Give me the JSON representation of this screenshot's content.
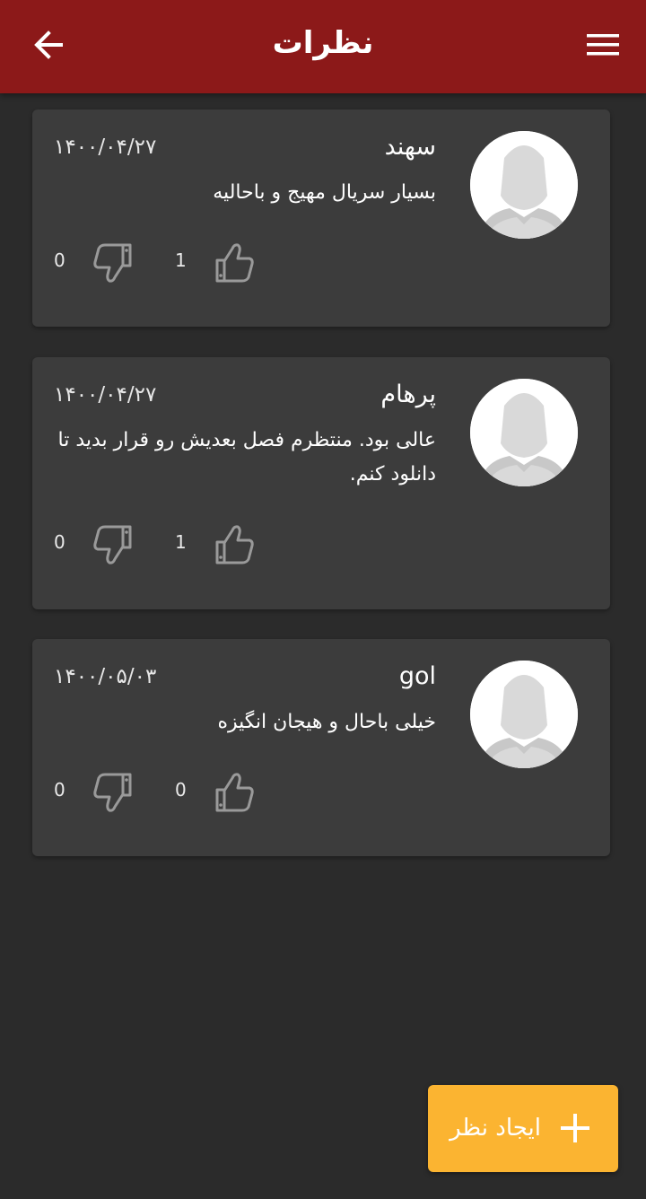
{
  "appbar": {
    "title": "نظرات",
    "back_icon": "arrow-back-icon",
    "menu_icon": "hamburger-menu-icon",
    "background": "#8c1919"
  },
  "comments": [
    {
      "name": "سهند",
      "date": "۱۴۰۰/۰۴/۲۷",
      "text": "بسیار سریال مهیج و باحالیه",
      "likes": "1",
      "dislikes": "0"
    },
    {
      "name": "پرهام",
      "date": "۱۴۰۰/۰۴/۲۷",
      "text": "عالی بود. منتظرم فصل بعدیش رو قرار بدید تا دانلود کنم.",
      "likes": "1",
      "dislikes": "0"
    },
    {
      "name": "gol",
      "date": "۱۴۰۰/۰۵/۰۳",
      "text": "خیلی باحال و هیجان انگیزه",
      "likes": "0",
      "dislikes": "0"
    }
  ],
  "fab": {
    "label": "ایجاد نظر",
    "icon": "plus-icon",
    "color": "#fbb431"
  },
  "colors": {
    "background": "#2b2b2b",
    "card": "#3c3c3c",
    "icon_gray": "#9a9a9a"
  }
}
